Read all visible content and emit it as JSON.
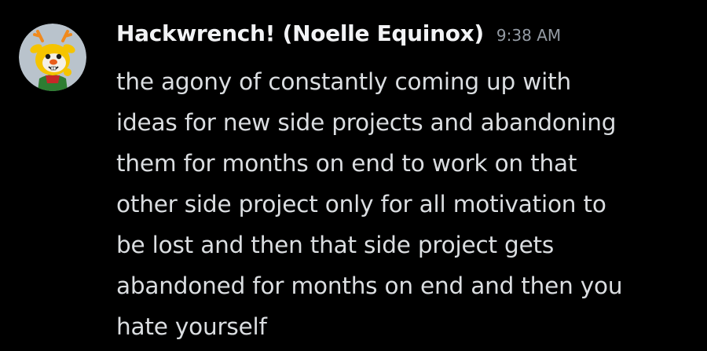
{
  "author": {
    "name": "Hackwrench! (Noelle Equinox)",
    "timestamp": "9:38 AM",
    "avatar_icon": "cartoon-deer-avatar-icon"
  },
  "message": {
    "lines": [
      "the agony of constantly coming up with",
      "ideas for new side projects and abandoning",
      "them for months on end to work on that",
      "other side project only for all motivation to",
      "be lost and then that side project gets",
      "abandoned for months on end and then you",
      "hate yourself"
    ]
  },
  "colors": {
    "background": "#000000",
    "username": "#f2f3f5",
    "timestamp": "#949ba4",
    "text": "#dbdee1"
  }
}
